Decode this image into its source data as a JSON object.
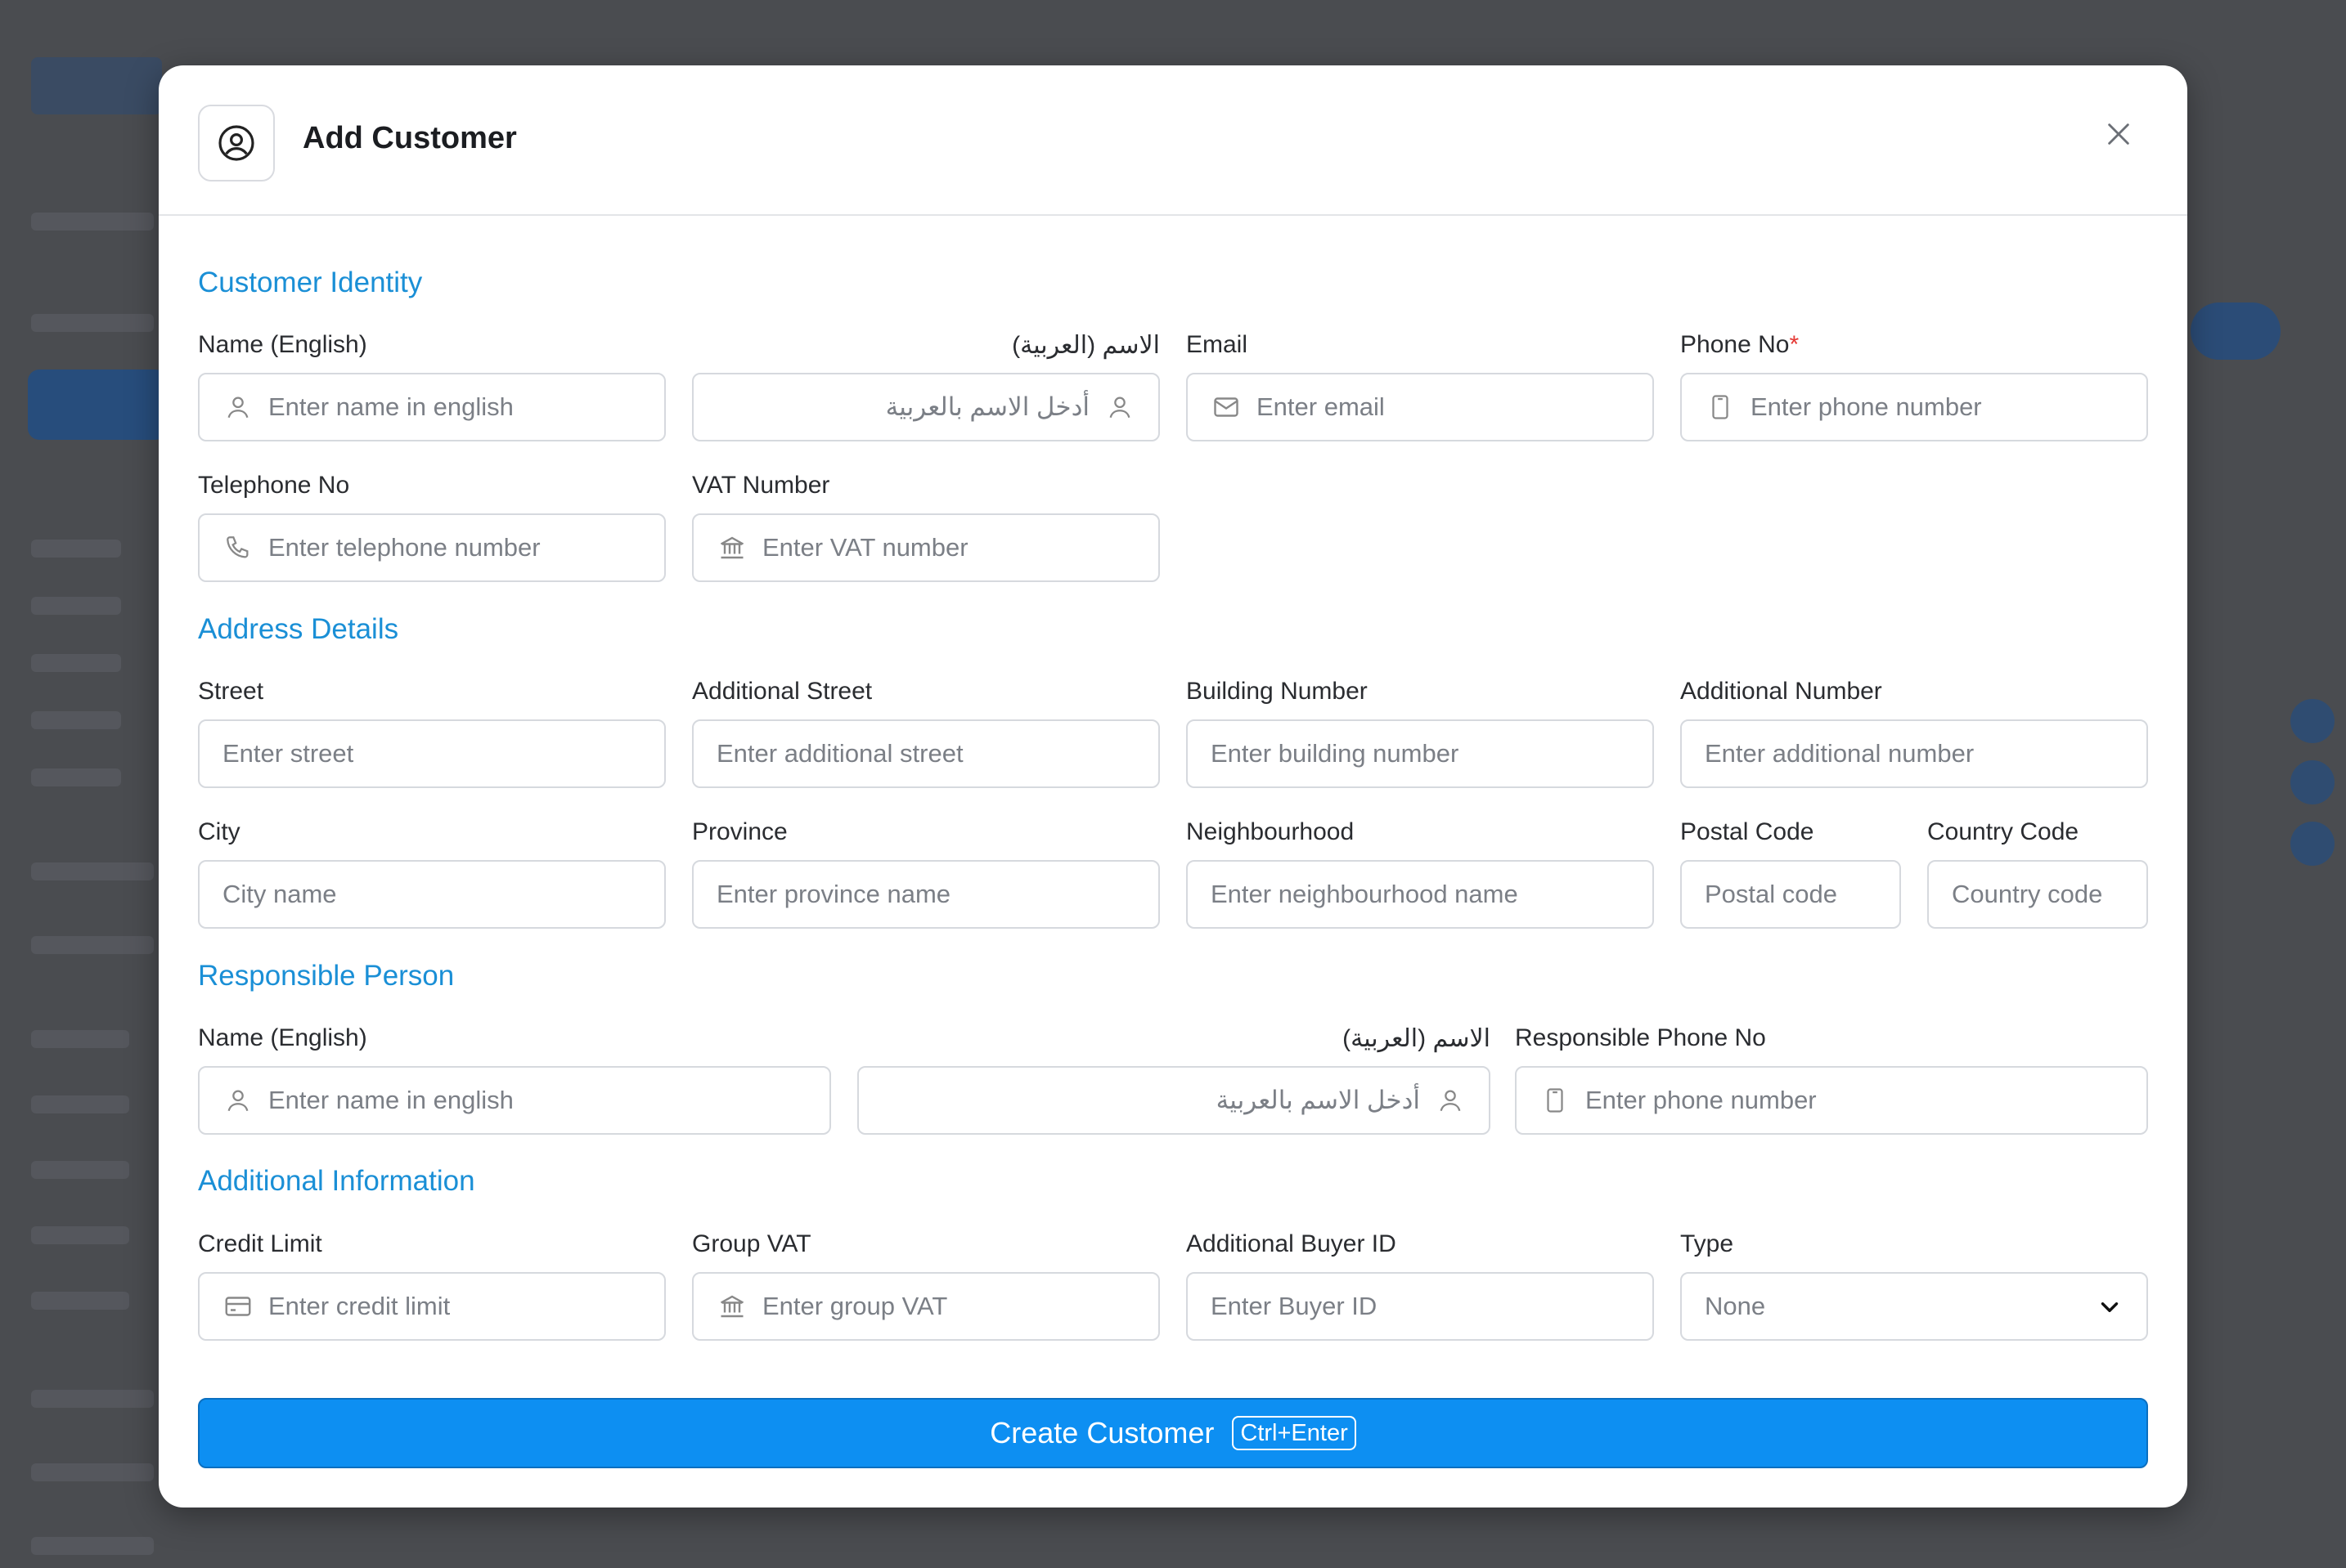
{
  "modal": {
    "title": "Add Customer",
    "submit_label": "Create Customer",
    "submit_shortcut": "Ctrl+Enter"
  },
  "sections": {
    "identity": "Customer Identity",
    "address": "Address Details",
    "responsible": "Responsible Person",
    "additional": "Additional Information"
  },
  "identity": {
    "name_en_label": "Name (English)",
    "name_en_placeholder": "Enter name in english",
    "name_ar_label": "الاسم (العربية)",
    "name_ar_placeholder": "أدخل الاسم بالعربية",
    "email_label": "Email",
    "email_placeholder": "Enter email",
    "phone_label": "Phone No",
    "phone_required": "*",
    "phone_placeholder": "Enter phone number",
    "telephone_label": "Telephone No",
    "telephone_placeholder": "Enter telephone number",
    "vat_label": "VAT Number",
    "vat_placeholder": "Enter VAT number"
  },
  "address": {
    "street_label": "Street",
    "street_placeholder": "Enter street",
    "additional_street_label": "Additional Street",
    "additional_street_placeholder": "Enter additional street",
    "building_label": "Building Number",
    "building_placeholder": "Enter building number",
    "additional_number_label": "Additional Number",
    "additional_number_placeholder": "Enter additional number",
    "city_label": "City",
    "city_placeholder": "City name",
    "province_label": "Province",
    "province_placeholder": "Enter province name",
    "neighbourhood_label": "Neighbourhood",
    "neighbourhood_placeholder": "Enter neighbourhood name",
    "postal_label": "Postal Code",
    "postal_placeholder": "Postal code",
    "country_label": "Country Code",
    "country_placeholder": "Country code"
  },
  "responsible": {
    "name_en_label": "Name (English)",
    "name_en_placeholder": "Enter name in english",
    "name_ar_label": "الاسم (العربية)",
    "name_ar_placeholder": "أدخل الاسم بالعربية",
    "phone_label": "Responsible Phone No",
    "phone_placeholder": "Enter phone number"
  },
  "additional": {
    "credit_label": "Credit Limit",
    "credit_placeholder": "Enter credit limit",
    "group_vat_label": "Group VAT",
    "group_vat_placeholder": "Enter group VAT",
    "buyer_label": "Additional Buyer ID",
    "buyer_placeholder": "Enter Buyer ID",
    "type_label": "Type",
    "type_value": "None"
  },
  "colors": {
    "accent": "#1a8fd6",
    "primary_button": "#0d8ff2",
    "required": "#e53935",
    "overlay": "#4a4c50"
  }
}
